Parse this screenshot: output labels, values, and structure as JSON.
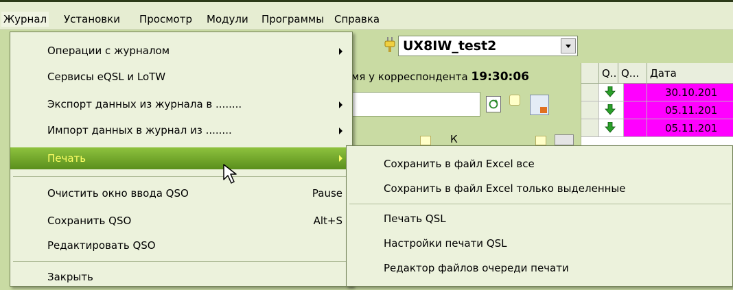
{
  "menubar": {
    "items": [
      "Журнал",
      "Установки",
      "Просмотр",
      "Модули",
      "Программы",
      "Справка"
    ]
  },
  "toolbar": {
    "callsign": "UX8IW_test2"
  },
  "corr_time": {
    "label": "мя у корреспондента",
    "value": "19:30:06"
  },
  "table": {
    "headers": [
      "Q..",
      "Q...",
      "Дата"
    ],
    "rows": [
      {
        "date": "30.10.201"
      },
      {
        "date": "05.11.201"
      },
      {
        "date": "05.11.201"
      }
    ]
  },
  "partial_label": "К",
  "main_menu": {
    "items": [
      {
        "label": "Операции с журналом",
        "shortcut": "",
        "submenu": true
      },
      {
        "label": "Сервисы eQSL и LoTW",
        "shortcut": "",
        "submenu": false
      },
      {
        "label": "Экспорт данных из журнала в ........",
        "shortcut": "",
        "submenu": true
      },
      {
        "label": "Импорт данных в журнал из ........",
        "shortcut": "",
        "submenu": true
      },
      {
        "label": "Печать",
        "shortcut": "",
        "submenu": true
      },
      {
        "label": "Очистить окно ввода QSO",
        "shortcut": "Pause",
        "submenu": false
      },
      {
        "label": "Сохранить QSO",
        "shortcut": "Alt+S",
        "submenu": false
      },
      {
        "label": "Редактировать QSO",
        "shortcut": "",
        "submenu": false
      },
      {
        "label": "Закрыть",
        "shortcut": "",
        "submenu": false
      }
    ],
    "highlighted_index": 4
  },
  "print_submenu": {
    "items": [
      "Сохранить в файл Excel все",
      "Сохранить в файл Excel только выделенные",
      "Печать QSL",
      "Настройки печати QSL",
      "Редактор файлов очереди печати"
    ]
  },
  "colors": {
    "menu_bg": "#ecf2dc",
    "highlight_top": "#8ec23e",
    "highlight_bottom": "#5a8f1c",
    "highlight_text": "#ffff66",
    "row_pink": "#ff00ff",
    "window_bg": "#c9dba3"
  }
}
